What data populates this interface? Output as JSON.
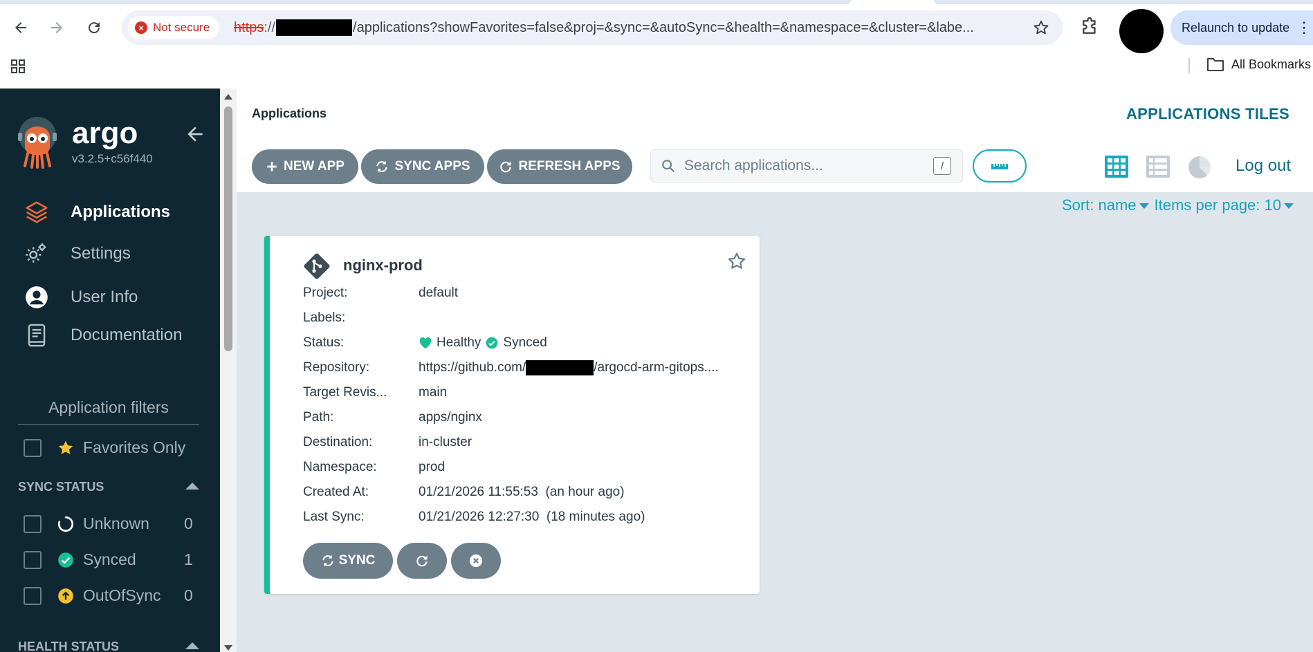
{
  "browser": {
    "security_label": "Not secure",
    "url_scheme": "https",
    "url_sep": "://",
    "url_path": "/applications?showFavorites=false&proj=&sync=&autoSync=&health=&namespace=&cluster=&labe...",
    "relaunch_label": "Relaunch to update",
    "bookmarks_label": "All Bookmarks"
  },
  "sidebar": {
    "brand": "argo",
    "version": "v3.2.5+c56f440",
    "nav": [
      {
        "label": "Applications",
        "icon": "layers-icon",
        "active": true
      },
      {
        "label": "Settings",
        "icon": "gears-icon",
        "active": false
      },
      {
        "label": "User Info",
        "icon": "user-circle-icon",
        "active": false
      },
      {
        "label": "Documentation",
        "icon": "book-icon",
        "active": false
      }
    ],
    "filters_title": "Application filters",
    "favorites_label": "Favorites Only",
    "sync_status": {
      "header": "SYNC STATUS",
      "items": [
        {
          "label": "Unknown",
          "count": "0",
          "icon": "circle-notch-icon"
        },
        {
          "label": "Synced",
          "count": "1",
          "icon": "check-circle-icon"
        },
        {
          "label": "OutOfSync",
          "count": "0",
          "icon": "arrow-up-circle-icon"
        }
      ]
    },
    "health_status": {
      "header": "HEALTH STATUS"
    }
  },
  "main": {
    "breadcrumb": "Applications",
    "page_title": "APPLICATIONS TILES",
    "toolbar": {
      "new_app": "NEW APP",
      "sync_apps": "SYNC APPS",
      "refresh_apps": "REFRESH APPS",
      "search_placeholder": "Search applications...",
      "search_shortcut": "/",
      "logout": "Log out"
    },
    "sort": {
      "sort_label": "Sort: name",
      "per_page_label": "Items per page: 10"
    }
  },
  "app_card": {
    "name": "nginx-prod",
    "fields": {
      "project_label": "Project:",
      "project": "default",
      "labels_label": "Labels:",
      "labels": "",
      "status_label": "Status:",
      "health": "Healthy",
      "sync": "Synced",
      "repo_label": "Repository:",
      "repo_prefix": "https://github.com/",
      "repo_suffix": "/argocd-arm-gitops....",
      "revision_label": "Target Revis...",
      "revision": "main",
      "path_label": "Path:",
      "path": "apps/nginx",
      "destination_label": "Destination:",
      "destination": "in-cluster",
      "namespace_label": "Namespace:",
      "namespace": "prod",
      "created_label": "Created At:",
      "created": "01/21/2026 11:55:53  (an hour ago)",
      "lastsync_label": "Last Sync:",
      "lastsync": "01/21/2026 12:27:30  (18 minutes ago)"
    },
    "sync_button": "SYNC"
  },
  "colors": {
    "sidebar_bg": "#0f2733",
    "accent_teal": "#18a0bc",
    "healthy_green": "#18be94",
    "button_gray": "#6d7f8b",
    "outofsync_yellow": "#f4c030"
  }
}
